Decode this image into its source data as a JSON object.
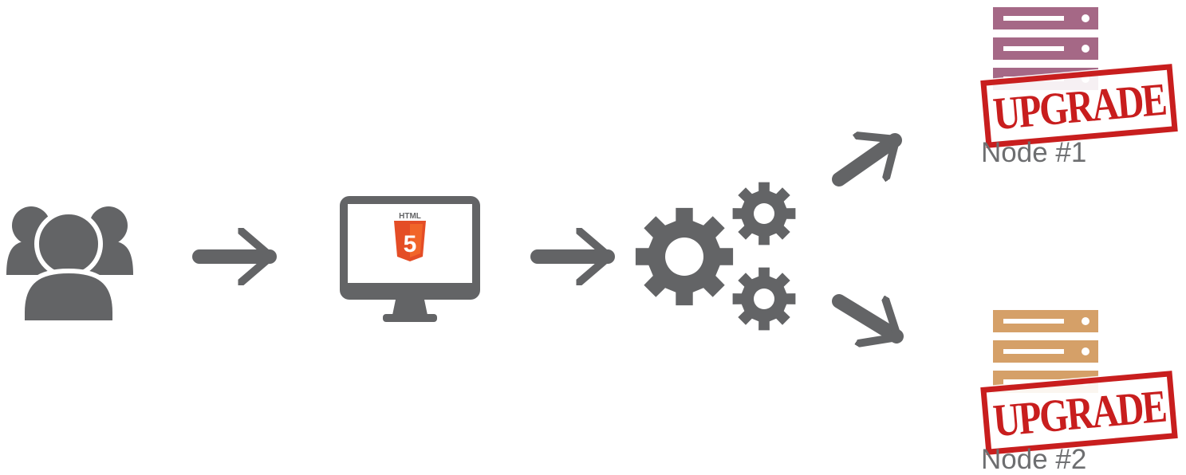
{
  "icons": {
    "users": "users-group-icon",
    "monitor": "monitor-icon",
    "html5": "html5-logo-icon",
    "gears": "gears-icon",
    "server": "server-icon",
    "arrow": "arrow-icon"
  },
  "html5_label": "HTML",
  "html5_digit": "5",
  "nodes": [
    {
      "label": "Node #1",
      "stamp": "UPGRADE",
      "color": "#a56886"
    },
    {
      "label": "Node #2",
      "stamp": "UPGRADE",
      "color": "#d5a068"
    }
  ],
  "colors": {
    "icon_gray": "#636466",
    "label_gray": "#6d6e70",
    "stamp_red": "#c81e1e",
    "html5_orange": "#e44d26",
    "html5_orange_light": "#f16529"
  }
}
